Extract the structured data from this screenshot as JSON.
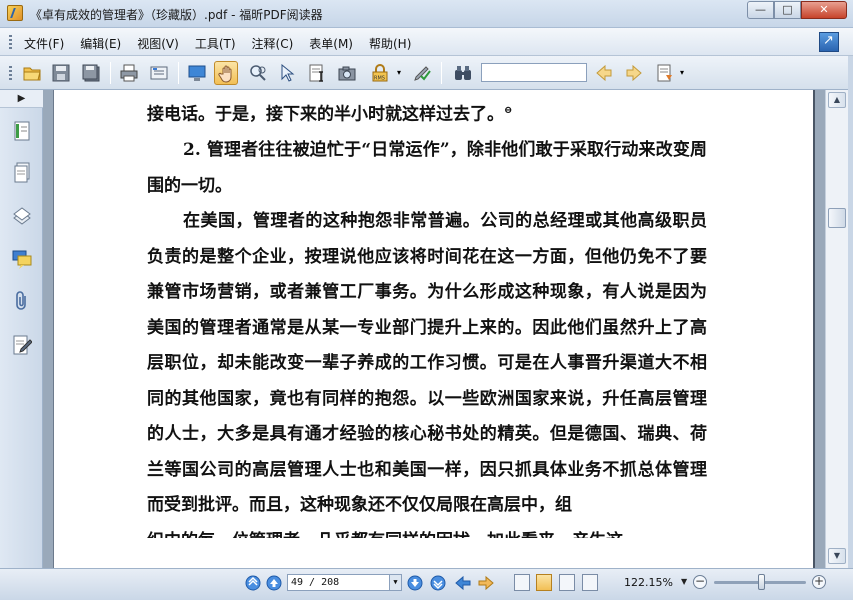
{
  "window": {
    "title": "《卓有成效的管理者》（珍藏版）.pdf - 福昕PDF阅读器",
    "minimize": "—",
    "maximize": "□",
    "close": "✕"
  },
  "menu": {
    "items": [
      "文件(F)",
      "编辑(E)",
      "视图(V)",
      "工具(T)",
      "注释(C)",
      "表单(M)",
      "帮助(H)"
    ]
  },
  "toolbar": {
    "search_value": "",
    "icons": [
      "open-folder",
      "save",
      "save-as",
      "print",
      "properties",
      "fullscreen",
      "hand-tool",
      "snapshot-zoom",
      "select-arrow",
      "text-select",
      "camera",
      "rms",
      "sign",
      "binoculars",
      "search-prev",
      "search-next",
      "annotation-list"
    ]
  },
  "document": {
    "paragraphs": [
      {
        "text": "接电话。于是，接下来的半小时就这样过去了。",
        "indent": false,
        "footnote": "⊖"
      },
      {
        "text": "2. 管理者往往被迫忙于“日常运作”，除非他们敢于采取行动来改变周围的一切。",
        "indent": true
      },
      {
        "text": "在美国，管理者的这种抱怨非常普遍。公司的总经理或其他高级职员负责的是整个企业，按理说他应该将时间花在这一方面，但他仍免不了要兼管市场营销，或者兼管工厂事务。为什么形成这种现象，有人说是因为美国的管理者通常是从某一专业部门提升上来的。因此他们虽然升上了高层职位，却未能改变一辈子养成的工作习惯。可是在人事晋升渠道大不相同的其他国家，竟也有同样的抱怨。以一些欧洲国家来说，升任高层管理的人士，大多是具有通才经验的核心秘书处的精英。但是德国、瑞典、荷兰等国公司的高层管理人士也和美国一样，因只抓具体业务不抓总体管理而受到批评。而且，这种现象还不仅仅局限在高层中，组",
        "indent": true
      },
      {
        "text": "织中的每一位管理者，几乎都有同样的困扰。加此看来，产生这",
        "indent": false
      }
    ]
  },
  "status": {
    "page_display": "49 / 208",
    "current_page": 49,
    "total_pages": 208,
    "zoom": "122.15%",
    "zoom_slider_fraction": 0.48
  }
}
